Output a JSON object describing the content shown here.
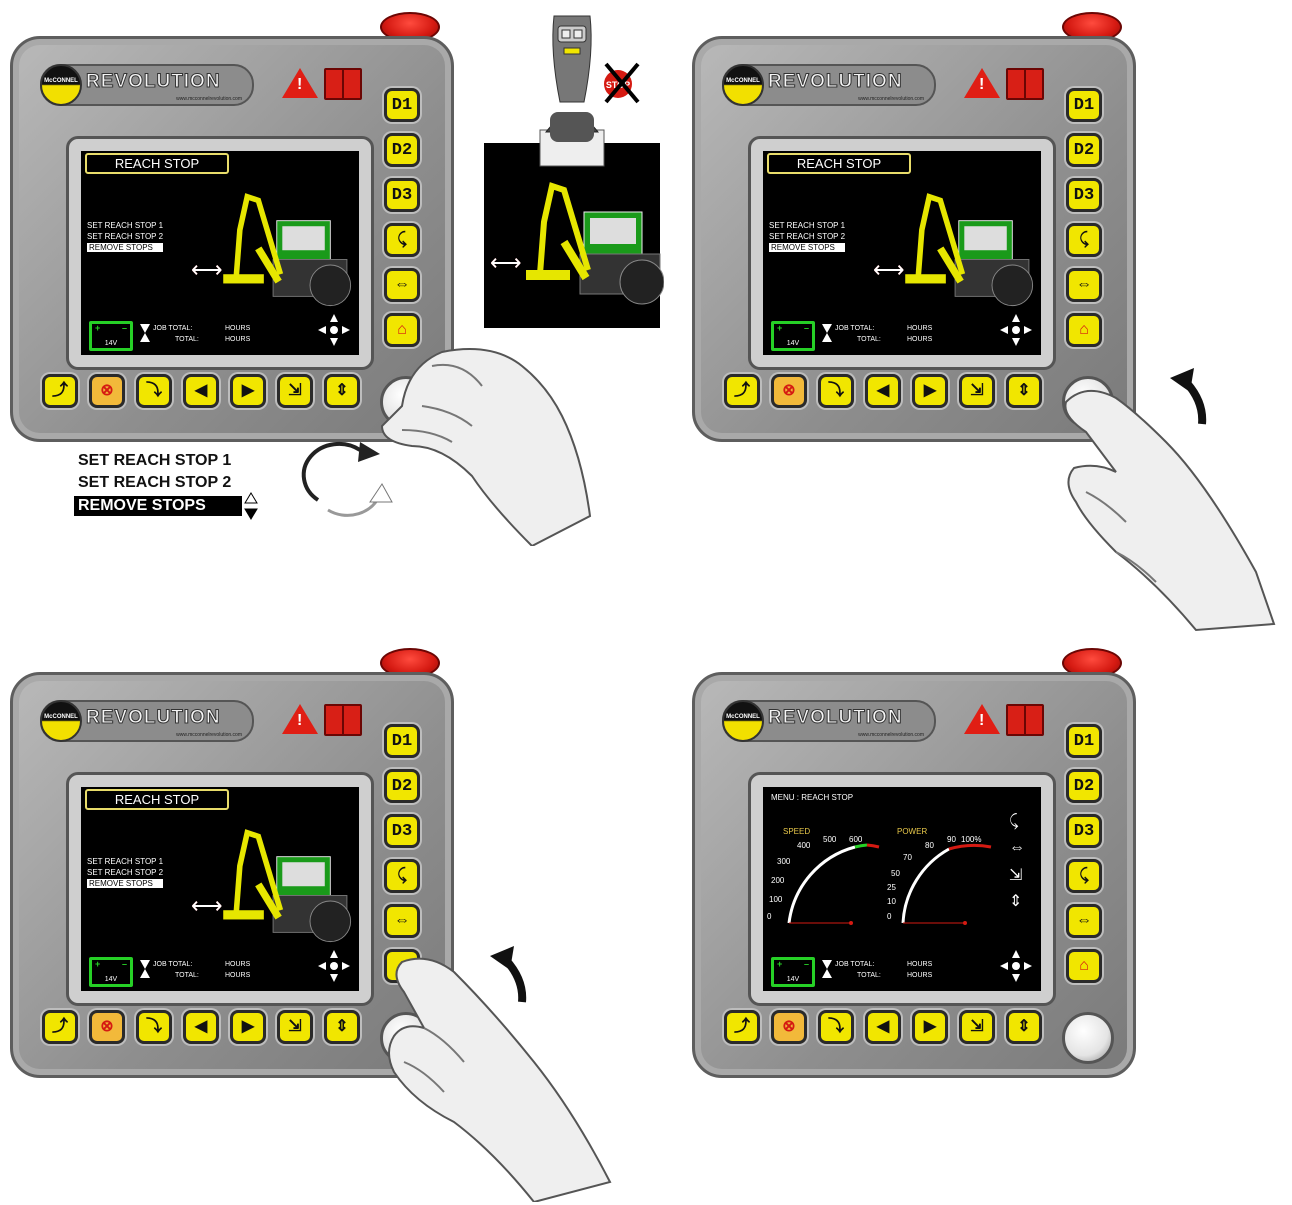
{
  "logo": {
    "word": "REVOLUTION",
    "badge": "McCONNEL",
    "url": "www.mcconnelrevolution.com"
  },
  "side_buttons": [
    "D1",
    "D2",
    "D3"
  ],
  "screen": {
    "title": "REACH STOP",
    "menu": [
      "SET REACH STOP 1",
      "SET REACH STOP 2",
      "REMOVE STOPS"
    ],
    "selected_index": 2,
    "battery": "14V",
    "job_total_label": "JOB TOTAL:",
    "total_label": "TOTAL:",
    "hours_label": "HOURS"
  },
  "gauge_screen": {
    "menu_title": "MENU : REACH STOP",
    "speed_label": "SPEED",
    "speed_ticks": [
      "0",
      "100",
      "200",
      "300",
      "400",
      "500",
      "600"
    ],
    "power_label": "POWER",
    "power_ticks": [
      "0",
      "10",
      "25",
      "50",
      "70",
      "80",
      "90",
      "100%"
    ]
  },
  "callout": {
    "items": [
      "SET REACH STOP 1",
      "SET REACH STOP 2",
      "REMOVE STOPS"
    ],
    "selected_index": 2
  },
  "colors": {
    "button_yellow": "#f1e600",
    "estop_red": "#d51a12",
    "battery_green": "#26d026",
    "boom_yellow": "#e6e600",
    "tractor_green": "#1a9a1a"
  }
}
